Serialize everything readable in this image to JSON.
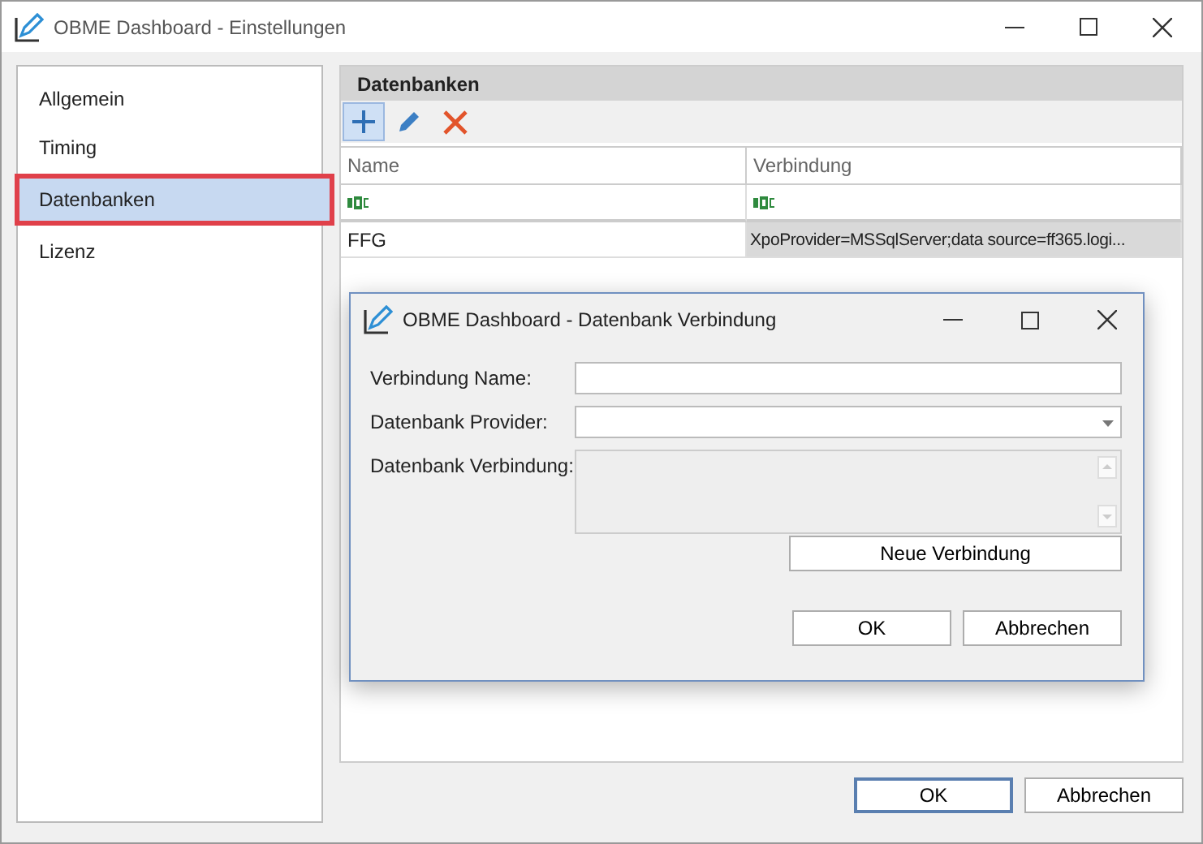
{
  "window": {
    "title": "OBME Dashboard - Einstellungen"
  },
  "sidebar": {
    "items": [
      {
        "label": "Allgemein",
        "selected": false
      },
      {
        "label": "Timing",
        "selected": false
      },
      {
        "label": "Datenbanken",
        "selected": true
      },
      {
        "label": "Lizenz",
        "selected": false
      }
    ]
  },
  "panel": {
    "title": "Datenbanken",
    "toolbar": [
      {
        "kind": "add",
        "selected": true
      },
      {
        "kind": "edit",
        "selected": false
      },
      {
        "kind": "delete",
        "selected": false
      }
    ],
    "table": {
      "columns": [
        "Name",
        "Verbindung"
      ],
      "filter_row": {
        "kind": "text-filter"
      },
      "rows": [
        {
          "cells": [
            {
              "text": "FFG",
              "selected": false
            },
            {
              "text": "XpoProvider=MSSqlServer;data source=ff365.logi...",
              "selected": true
            }
          ]
        }
      ]
    }
  },
  "buttons": [
    {
      "label": "OK",
      "default": true
    },
    {
      "label": "Abbrechen",
      "default": false
    }
  ],
  "dialog": {
    "title": "OBME Dashboard - Datenbank Verbindung",
    "fields": [
      {
        "label": "Verbindung Name:",
        "kind": "text",
        "disabled": false
      },
      {
        "label": "Datenbank Provider:",
        "kind": "combo",
        "disabled": false
      },
      {
        "label": "Datenbank Verbindung:",
        "kind": "memo",
        "disabled": true
      }
    ],
    "action": {
      "label": "Neue Verbindung"
    },
    "buttons": [
      {
        "label": "OK",
        "default": false
      },
      {
        "label": "Abbrechen",
        "default": false
      }
    ]
  }
}
